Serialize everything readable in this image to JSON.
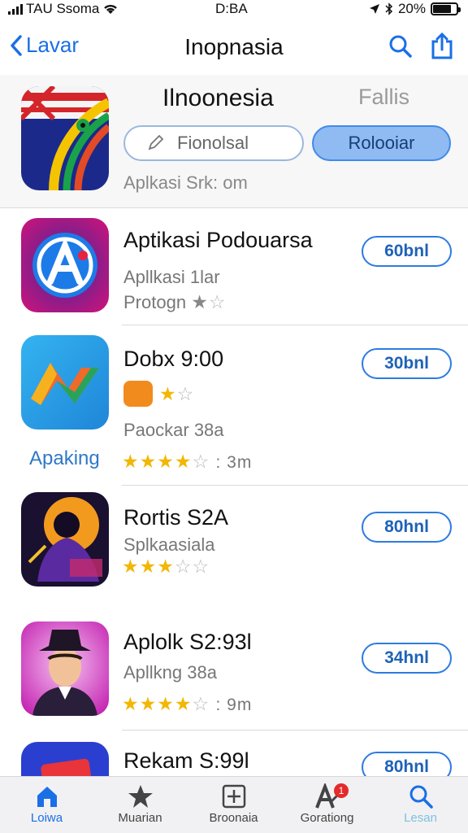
{
  "status": {
    "carrier": "TAU Ssoma",
    "time": "D:BA",
    "battery": "20%"
  },
  "nav": {
    "back_label": "Lavar",
    "title": "Inopnasia"
  },
  "header": {
    "title": "Ilnoonesia",
    "side_label": "Fallis",
    "field_text": "Fionolsal",
    "primary_button": "Rolooiar",
    "subtitle": "Aplkasi Srk: om"
  },
  "apps": [
    {
      "name": "Aptikasi Podouarsa",
      "sub1": "Apllkasi 1lar",
      "sub2": "Protogn",
      "get": "60bnl",
      "rating": 1,
      "meta": ""
    },
    {
      "name": "Dobx 9:00",
      "sub1": "Paockar 38a",
      "get": "30bnl",
      "rating": 4,
      "meta": ": 3m",
      "extra": "Apaking"
    },
    {
      "name": "Rortis S2A",
      "sub1": "Splkaasiala",
      "get": "80hnl",
      "rating": 3,
      "meta": ""
    },
    {
      "name": "Aplolk S2:93l",
      "sub1": "Apllkng 38a",
      "get": "34hnl",
      "rating": 4,
      "meta": ": 9m"
    },
    {
      "name": "Rekam S:99l",
      "get": "80hnl"
    }
  ],
  "tabs": [
    {
      "label": "Loiwa",
      "icon": "home-icon"
    },
    {
      "label": "Muarian",
      "icon": "star-icon"
    },
    {
      "label": "Broonaia",
      "icon": "plus-square-icon"
    },
    {
      "label": "Gorationg",
      "icon": "badge-icon",
      "badge": "1"
    },
    {
      "label": "Lesan",
      "icon": "search-icon"
    }
  ],
  "colors": {
    "accent": "#1a6fe6",
    "star": "#f2b705",
    "badge": "#e52a2a"
  }
}
